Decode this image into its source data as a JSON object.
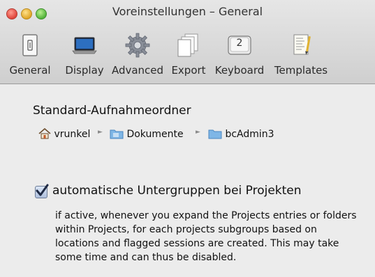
{
  "window": {
    "title": "Voreinstellungen – General"
  },
  "toolbar": {
    "tabs": [
      {
        "label": "General",
        "icon": "switch-icon"
      },
      {
        "label": "Display",
        "icon": "laptop-icon"
      },
      {
        "label": "Advanced",
        "icon": "gear-icon"
      },
      {
        "label": "Export",
        "icon": "documents-icon"
      },
      {
        "label": "Keyboard",
        "icon": "key-2-icon",
        "key": "2"
      },
      {
        "label": "Templates",
        "icon": "template-icon"
      }
    ],
    "selected": "General"
  },
  "recording_folder": {
    "title": "Standard-Aufnahmeordner",
    "path": [
      "vrunkel",
      "Dokumente",
      "bcAdmin3"
    ],
    "separator": "►"
  },
  "auto_subgroups": {
    "checked": true,
    "label": "automatische Untergruppen bei Projekten",
    "description": "if active, whenever you expand the Projects entries or folders within Projects, for each projects subgroups based on locations and flagged sessions are created. This may take some time and can thus be disabled."
  },
  "colors": {
    "accent": "#2b5fb8",
    "folder": "#7fb6e6"
  }
}
